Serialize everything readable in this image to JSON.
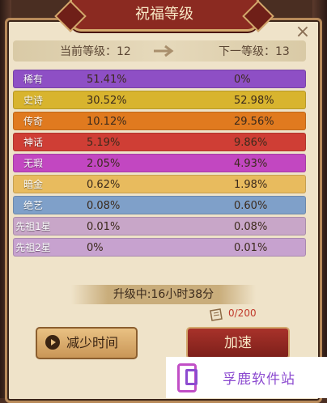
{
  "title": "祝福等级",
  "close_icon": "×",
  "level": {
    "current_label": "当前等级：12",
    "next_label": "下一等级：13"
  },
  "rows": [
    {
      "name": "稀有",
      "current": "51.41%",
      "next": "0%",
      "color": "#8e4fc5"
    },
    {
      "name": "史诗",
      "current": "30.52%",
      "next": "52.98%",
      "color": "#d8b42e"
    },
    {
      "name": "传奇",
      "current": "10.12%",
      "next": "29.56%",
      "color": "#e07a1f"
    },
    {
      "name": "神话",
      "current": "5.19%",
      "next": "9.86%",
      "color": "#cf3e35"
    },
    {
      "name": "无瑕",
      "current": "2.05%",
      "next": "4.93%",
      "color": "#c247c1"
    },
    {
      "name": "暗金",
      "current": "0.62%",
      "next": "1.98%",
      "color": "#e8bb5e"
    },
    {
      "name": "绝艺",
      "current": "0.08%",
      "next": "0.60%",
      "color": "#7fa0c9"
    },
    {
      "name": "先祖1星",
      "current": "0.01%",
      "next": "0.08%",
      "color": "#c8a6c8"
    },
    {
      "name": "先祖2星",
      "current": "0%",
      "next": "0.01%",
      "color": "#c7a2cf"
    }
  ],
  "upgrade": {
    "text": "升级中:16小时38分"
  },
  "cost": {
    "text": "0/200"
  },
  "buttons": {
    "reduce_label": "减少时间",
    "speed_label": "加速"
  },
  "watermark": {
    "text": "孚鹿软件站"
  }
}
